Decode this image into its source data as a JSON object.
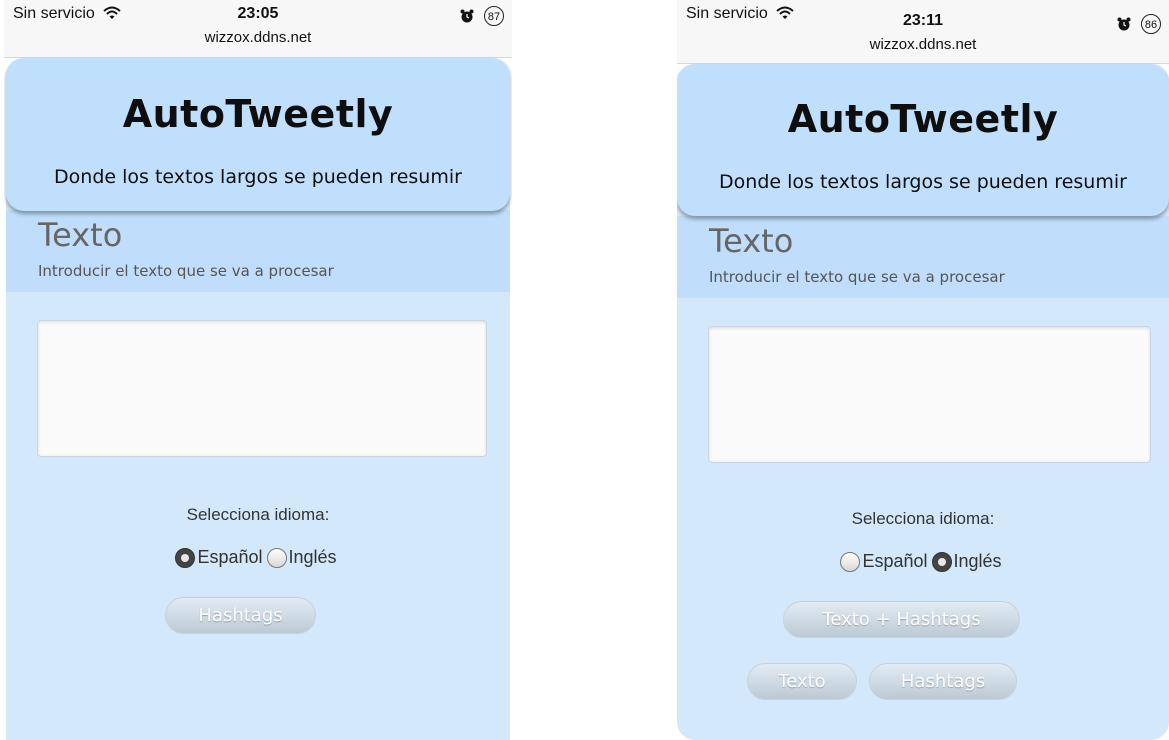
{
  "screens": [
    {
      "status": {
        "carrier": "Sin servicio",
        "time": "23:05",
        "url": "wizzox.ddns.net",
        "battery": "87"
      },
      "app": {
        "title": "AutoTweetly",
        "subtitle": "Donde los textos largos se pueden resumir"
      },
      "section": {
        "title": "Texto",
        "subtitle": "Introducir el texto que se va a procesar"
      },
      "input": {
        "value": ""
      },
      "language": {
        "label": "Selecciona idioma:",
        "options": [
          "Español",
          "Inglés"
        ],
        "selected": "Español"
      },
      "buttons": {
        "hashtags": "Hashtags"
      }
    },
    {
      "status": {
        "carrier": "Sin servicio",
        "time": "23:11",
        "url": "wizzox.ddns.net",
        "battery": "86"
      },
      "app": {
        "title": "AutoTweetly",
        "subtitle": "Donde los textos largos se pueden resumir"
      },
      "section": {
        "title": "Texto",
        "subtitle": "Introducir el texto que se va a procesar"
      },
      "input": {
        "value": ""
      },
      "language": {
        "label": "Selecciona idioma:",
        "options": [
          "Español",
          "Inglés"
        ],
        "selected": "Inglés"
      },
      "buttons": {
        "texto_hashtags": "Texto + Hashtags",
        "texto": "Texto",
        "hashtags": "Hashtags"
      }
    }
  ],
  "icons": {
    "wifi": "wifi-icon",
    "alarm": "alarm-clock-icon"
  }
}
